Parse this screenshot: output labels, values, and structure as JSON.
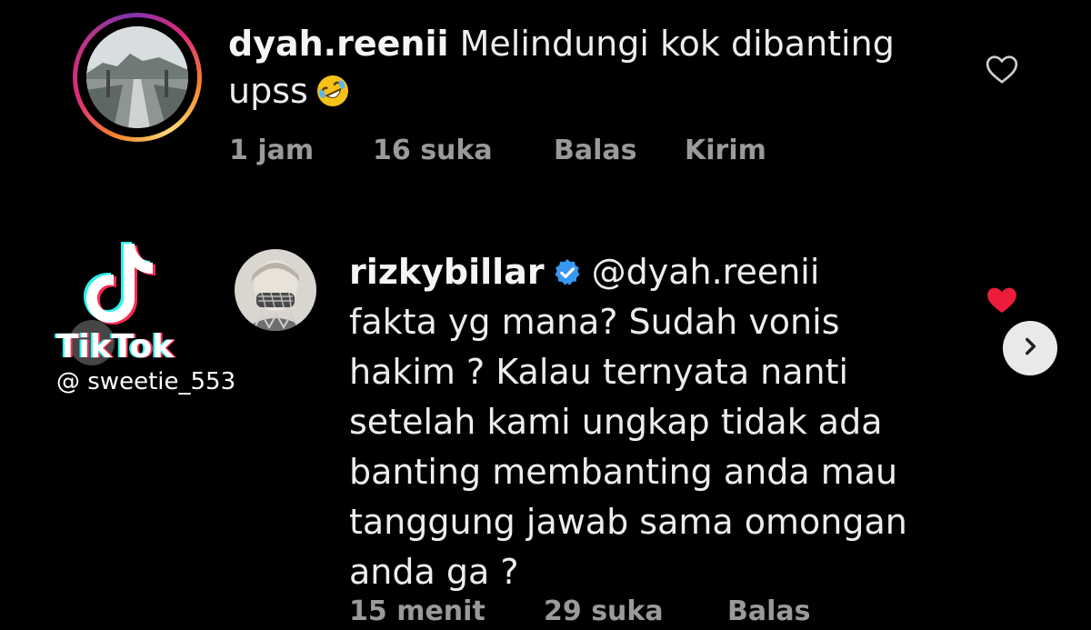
{
  "comments": [
    {
      "username": "dyah.reenii",
      "text_line1": "Melindungi kok dibanting",
      "text_line2": "upss",
      "emoji": "rolling-on-floor-laughing-emoji",
      "time": "1 jam",
      "likes": "16 suka",
      "reply": "Balas",
      "send": "Kirim",
      "liked": false
    },
    {
      "username": "rizkybillar",
      "verified": true,
      "mention": "@dyah.reenii",
      "text_lines": [
        "fakta yg mana? Sudah vonis",
        "hakim ? Kalau ternyata nanti",
        "setelah kami ungkap tidak ada",
        "banting membanting anda mau",
        "tanggung jawab sama omongan",
        "anda ga ?"
      ],
      "time": "15 menit",
      "likes": "29 suka",
      "reply": "Balas",
      "liked": true
    }
  ],
  "watermark": {
    "brand": "TikTok",
    "handle": "@ sweetie_553"
  },
  "icons": {
    "like": "heart-icon",
    "liked": "heart-filled-icon",
    "next": "chevron-right-icon",
    "verified": "verified-badge-icon"
  },
  "colors": {
    "background": "#000000",
    "verified_blue": "#3897f0",
    "liked_red": "#ed1c3b",
    "meta_gray": "#9a9a9a"
  }
}
